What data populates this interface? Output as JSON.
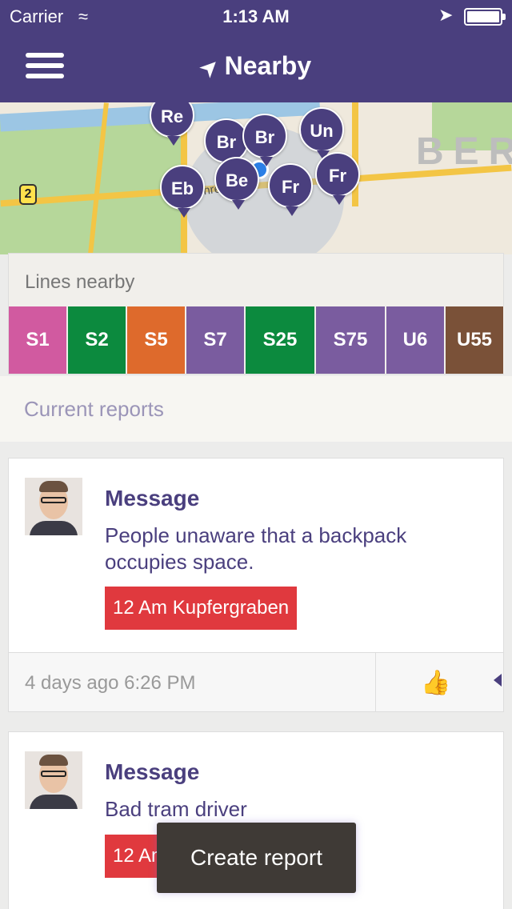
{
  "status_bar": {
    "carrier": "Carrier",
    "time": "1:13 AM"
  },
  "nav": {
    "title": "Nearby",
    "menu_icon": "hamburger-icon",
    "title_icon": "location-arrow-icon"
  },
  "map": {
    "city_label": "BER",
    "road_badge": "2",
    "street_label": "Behre",
    "markers": [
      "Re",
      "Br",
      "Br",
      "Un",
      "Eb",
      "Be",
      "Fr",
      "Fr"
    ]
  },
  "lines_nearby": {
    "title": "Lines nearby",
    "lines": [
      {
        "label": "S1",
        "color": "#d15aa0"
      },
      {
        "label": "S2",
        "color": "#0c8a3e"
      },
      {
        "label": "S5",
        "color": "#de6a2c"
      },
      {
        "label": "S7",
        "color": "#7a5c9f"
      },
      {
        "label": "S25",
        "color": "#0c8a3e"
      },
      {
        "label": "S75",
        "color": "#7a5c9f"
      },
      {
        "label": "U6",
        "color": "#7a5c9f"
      },
      {
        "label": "U55",
        "color": "#7a5138"
      }
    ]
  },
  "reports": {
    "header": "Current reports",
    "items": [
      {
        "title": "Message",
        "text": "People unaware that a backpack occupies space.",
        "stop": "12 Am Kupfergraben",
        "time": "4 days ago 6:26 PM"
      },
      {
        "title": "Message",
        "text": "Bad tram driver",
        "stop": "12 Am"
      }
    ]
  },
  "create_button": "Create report",
  "colors": {
    "primary": "#4a3f7e",
    "tag_red": "#e0393e"
  }
}
